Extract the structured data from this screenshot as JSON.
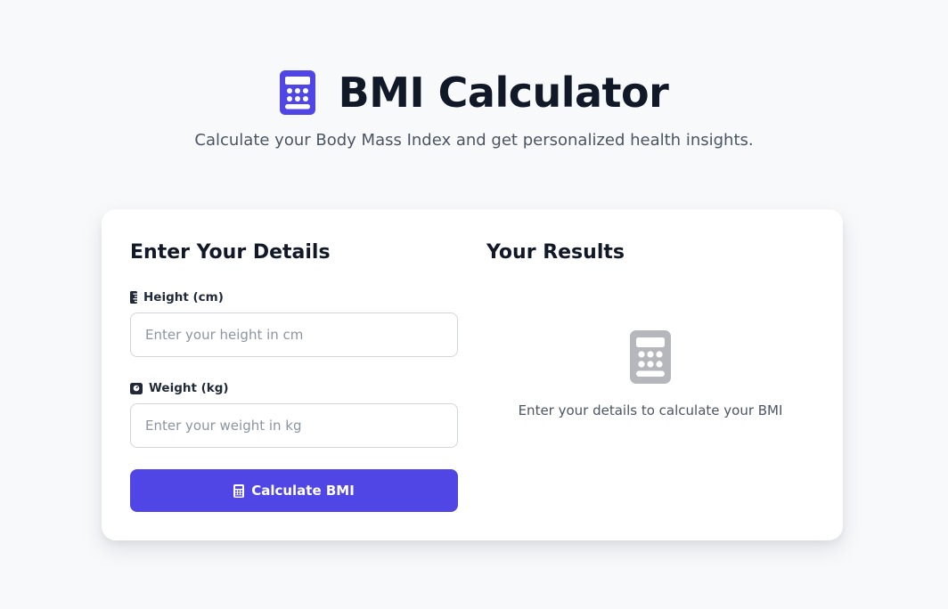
{
  "header": {
    "icon": "calculator-icon",
    "title": "BMI Calculator",
    "subtitle": "Calculate your Body Mass Index and get personalized health insights."
  },
  "form": {
    "title": "Enter Your Details",
    "height": {
      "icon": "ruler-icon",
      "label": "Height (cm)",
      "value": "",
      "placeholder": "Enter your height in cm"
    },
    "weight": {
      "icon": "weight-icon",
      "label": "Weight (kg)",
      "value": "",
      "placeholder": "Enter your weight in kg"
    },
    "button": {
      "icon": "calculator-icon",
      "label": "Calculate BMI"
    }
  },
  "results": {
    "title": "Your Results",
    "empty_icon": "calculator-icon",
    "empty_text": "Enter your details to calculate your BMI"
  },
  "colors": {
    "accent": "#4f46e5",
    "background": "#f8f9fb",
    "card": "#ffffff",
    "muted_icon": "#b5b7bd",
    "heading": "#111827"
  }
}
